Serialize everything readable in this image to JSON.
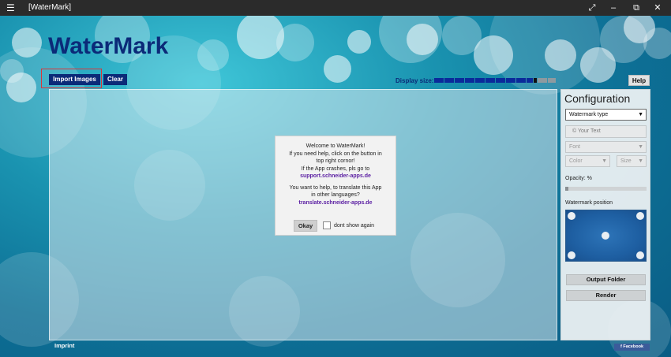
{
  "window": {
    "title": "[WaterMark]",
    "menu_icon": "hamburger-icon",
    "controls": [
      "expand-icon",
      "minimize-icon",
      "restore-icon",
      "close-icon"
    ]
  },
  "app": {
    "title": "WaterMark"
  },
  "toolbar": {
    "import_label": "Import Images",
    "clear_label": "Clear",
    "display_size_label": "Display size:",
    "help_label": "Help"
  },
  "display_size_level": 0.77,
  "dialog": {
    "lines": [
      "Welcome to WaterMark!",
      "If you need help, click on the button in",
      "top right cornor!",
      "If the App crashes, pls go to"
    ],
    "support_link": "support.schneider-apps.de",
    "translate_lines": [
      "You want to help, to translate this App",
      "in other languages?"
    ],
    "translate_link": "translate.schneider-apps.de",
    "okay_label": "Okay",
    "dont_show_label": "dont show again"
  },
  "config": {
    "title": "Configuration",
    "watermark_type": "Watermark type",
    "text_placeholder": "© Your Text",
    "font_placeholder": "Font",
    "color_placeholder": "Color",
    "size_placeholder": "Size",
    "opacity_label": "Opacity: %",
    "opacity_level": 0.04,
    "position_label": "Watermark position",
    "output_folder_label": "Output Folder",
    "render_label": "Render"
  },
  "footer": {
    "imprint_label": "Imprint",
    "facebook_label": "f Facebook"
  },
  "colors": {
    "accent": "#0b2a78",
    "link": "#5a1ea2",
    "titlebar": "#2b2b2b",
    "facebook": "#3b5b9a"
  }
}
